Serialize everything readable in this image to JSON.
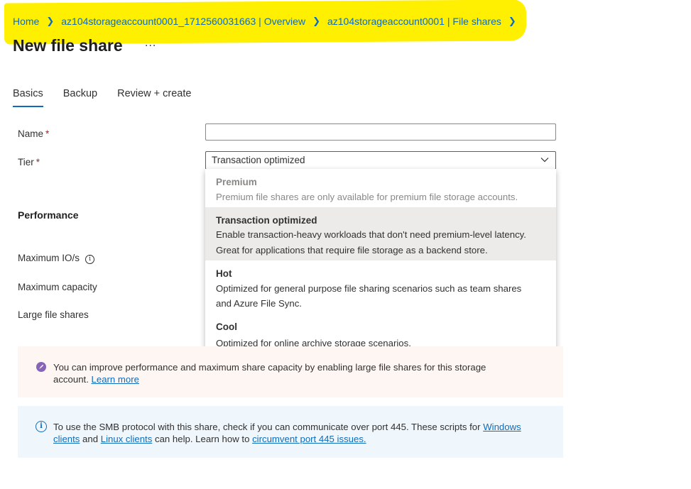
{
  "breadcrumb": [
    {
      "label": "Home"
    },
    {
      "label": "az104storageaccount0001_1712560031663 | Overview"
    },
    {
      "label": "az104storageaccount0001 | File shares"
    }
  ],
  "page_title": "New file share",
  "more_label": "...",
  "tabs": [
    {
      "label": "Basics",
      "active": true
    },
    {
      "label": "Backup",
      "active": false
    },
    {
      "label": "Review + create",
      "active": false
    }
  ],
  "form": {
    "name_label": "Name",
    "name_value": "",
    "tier_label": "Tier",
    "required_mark": "*",
    "tier_value": "Transaction optimized"
  },
  "performance": {
    "heading": "Performance",
    "max_io_label": "Maximum IO/s",
    "max_capacity_label": "Maximum capacity",
    "large_file_shares_label": "Large file shares"
  },
  "tier_options": [
    {
      "title": "Premium",
      "lines": [
        "Premium file shares are only available for premium file storage accounts."
      ],
      "disabled": true,
      "selected": false
    },
    {
      "title": "Transaction optimized",
      "lines": [
        "Enable transaction-heavy workloads that don't need premium-level latency.",
        "Great for applications that require file storage as a backend store."
      ],
      "disabled": false,
      "selected": true
    },
    {
      "title": "Hot",
      "lines": [
        "Optimized for general purpose file sharing scenarios such as team shares",
        "and Azure File Sync."
      ],
      "disabled": false,
      "selected": false
    },
    {
      "title": "Cool",
      "lines": [
        "Optimized for online archive storage scenarios."
      ],
      "disabled": false,
      "selected": false
    }
  ],
  "banners": {
    "large_shares": {
      "line1": "You can improve performance and maximum share capacity by enabling large file shares for this storage",
      "line2_prefix": "account. ",
      "link": "Learn more"
    },
    "smb": {
      "line1_prefix": "To use the SMB protocol with this share, check if you can communicate over port 445. These scripts for ",
      "windows_link_a": "Windows",
      "windows_link_b": "clients",
      "and": " and ",
      "linux_link": "Linux clients",
      "mid": " can help. Learn how to ",
      "circumvent_link": "circumvent port 445 issues."
    }
  },
  "colors": {
    "link": "#0f6cbd",
    "highlight": "#ffef00",
    "required": "#a4262c",
    "selected_option_bg": "#edebe9"
  }
}
